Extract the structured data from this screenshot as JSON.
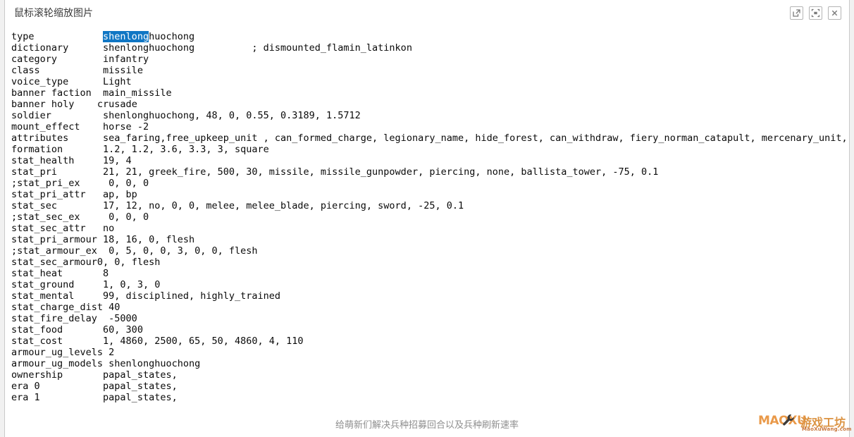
{
  "window": {
    "title": "鼠标滚轮缩放图片",
    "actions": [
      {
        "name": "open-external-button",
        "icon": "external-link-icon",
        "label": ""
      },
      {
        "name": "fit-screen-button",
        "icon": "fit-screen-icon",
        "label": ""
      },
      {
        "name": "close-button",
        "icon": "close-icon",
        "label": ""
      }
    ]
  },
  "selection": {
    "text": "shenlong",
    "highlight_color": "#1076c4",
    "text_color": "#ffffff"
  },
  "document": {
    "font": "monospace",
    "text_color": "#0a0a0a",
    "lines": [
      {
        "key": "type",
        "gap": "            ",
        "value_pre": "",
        "selected": "shenlong",
        "value": "huochong"
      },
      {
        "key": "dictionary",
        "gap": "      ",
        "value": "shenlonghuochong          ; dismounted_flamin_latinkon"
      },
      {
        "key": "category",
        "gap": "        ",
        "value": "infantry"
      },
      {
        "key": "class",
        "gap": "           ",
        "value": "missile"
      },
      {
        "key": "voice_type",
        "gap": "      ",
        "value": "Light"
      },
      {
        "key": "banner faction",
        "gap": "  ",
        "value": "main_missile"
      },
      {
        "key": "banner holy",
        "gap": "    ",
        "value": "crusade"
      },
      {
        "key": "soldier",
        "gap": "         ",
        "value": "shenlonghuochong, 48, 0, 0.55, 0.3189, 1.5712"
      },
      {
        "key": "mount_effect",
        "gap": "    ",
        "value": "horse -2"
      },
      {
        "key": "attributes",
        "gap": "      ",
        "value": "sea_faring,free_upkeep_unit , can_formed_charge, legionary_name, hide_forest, can_withdraw, fiery_norman_catapult, mercenary_unit,"
      },
      {
        "key": "formation",
        "gap": "       ",
        "value": "1.2, 1.2, 3.6, 3.3, 3, square"
      },
      {
        "key": "stat_health",
        "gap": "     ",
        "value": "19, 4"
      },
      {
        "key": "stat_pri",
        "gap": "        ",
        "value": "21, 21, greek_fire, 500, 30, missile, missile_gunpowder, piercing, none, ballista_tower, -75, 0.1"
      },
      {
        "key": ";stat_pri_ex",
        "gap": "     ",
        "value": "0, 0, 0"
      },
      {
        "key": "stat_pri_attr",
        "gap": "   ",
        "value": "ap, bp"
      },
      {
        "key": "stat_sec",
        "gap": "        ",
        "value": "17, 12, no, 0, 0, melee, melee_blade, piercing, sword, -25, 0.1"
      },
      {
        "key": ";stat_sec_ex",
        "gap": "     ",
        "value": "0, 0, 0"
      },
      {
        "key": "stat_sec_attr",
        "gap": "   ",
        "value": "no"
      },
      {
        "key": "stat_pri_armour",
        "gap": " ",
        "value": "18, 16, 0, flesh"
      },
      {
        "key": ";stat_armour_ex",
        "gap": "  ",
        "value": "0, 5, 0, 0, 3, 0, 0, flesh"
      },
      {
        "key": "stat_sec_armour",
        "gap": "",
        "value": "0, 0, flesh"
      },
      {
        "key": "stat_heat",
        "gap": "       ",
        "value": "8"
      },
      {
        "key": "stat_ground",
        "gap": "     ",
        "value": "1, 0, 3, 0"
      },
      {
        "key": "stat_mental",
        "gap": "     ",
        "value": "99, disciplined, highly_trained"
      },
      {
        "key": "stat_charge_dist",
        "gap": " ",
        "value": "40"
      },
      {
        "key": "stat_fire_delay",
        "gap": "  ",
        "value": "-5000"
      },
      {
        "key": "stat_food",
        "gap": "       ",
        "value": "60, 300"
      },
      {
        "key": "stat_cost",
        "gap": "       ",
        "value": "1, 4860, 2500, 65, 50, 4860, 4, 110"
      },
      {
        "key": "armour_ug_levels",
        "gap": " ",
        "value": "2"
      },
      {
        "key": "armour_ug_models",
        "gap": " ",
        "value": "shenlonghuochong"
      },
      {
        "key": "ownership",
        "gap": "       ",
        "value": "papal_states,"
      },
      {
        "key": "era 0",
        "gap": "           ",
        "value": "papal_states,"
      },
      {
        "key": "era 1",
        "gap": "           ",
        "value": "papal_states,"
      }
    ]
  },
  "caption": {
    "text": "给萌新们解决兵种招募回合以及兵种刷新速率",
    "color": "#8e8e8e"
  },
  "watermark": {
    "brand_latin": "MAOXU",
    "brand_cn": "游戏工坊",
    "url": "MaoXuWang.com",
    "color": "#e8913a"
  }
}
